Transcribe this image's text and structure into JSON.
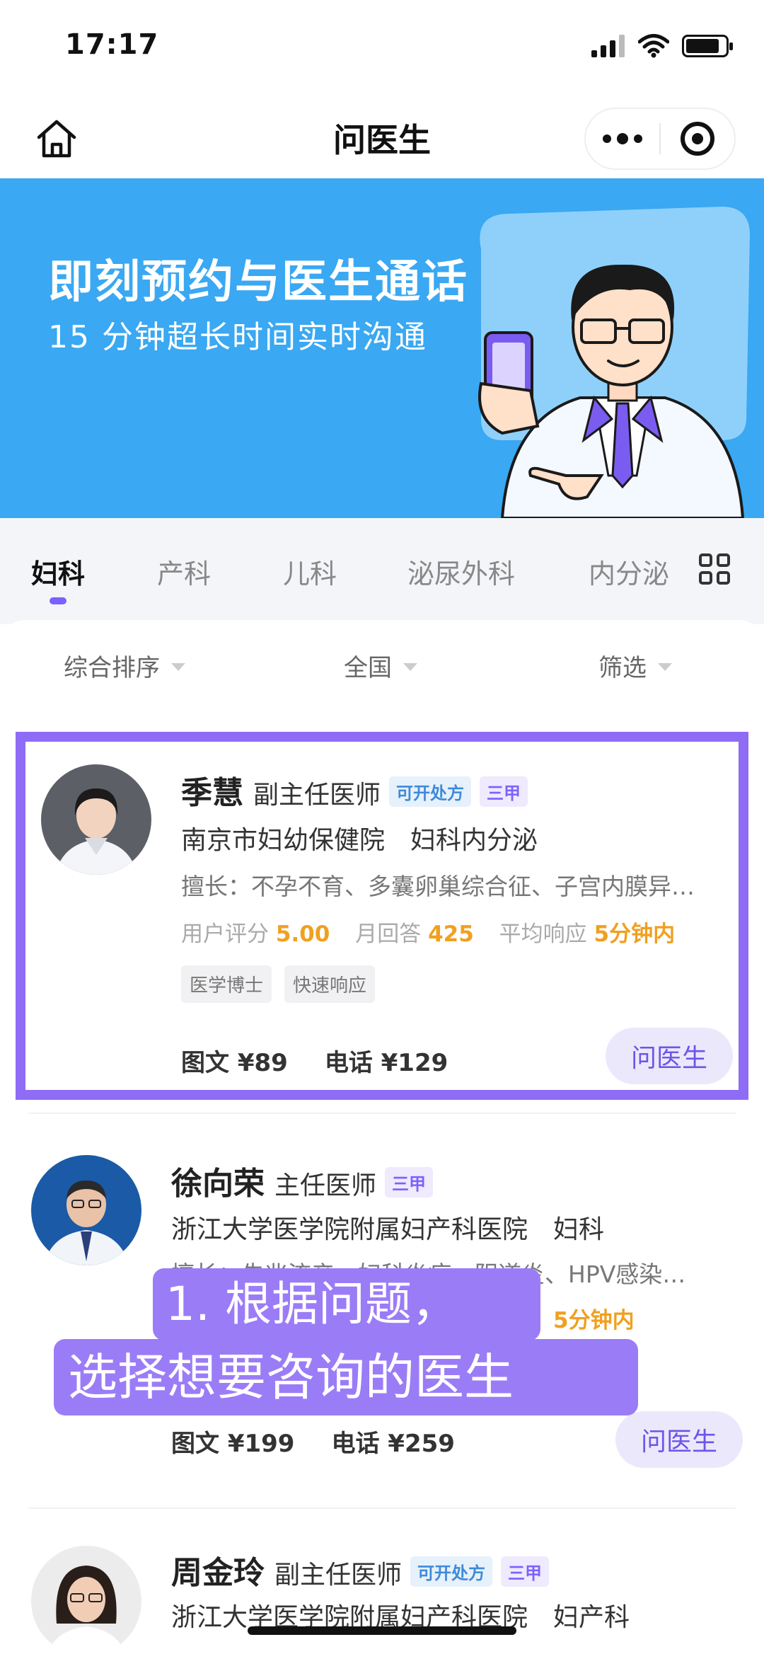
{
  "status_bar": {
    "time": "17:17"
  },
  "nav": {
    "title": "问医生"
  },
  "banner": {
    "title": "即刻预约与医生通话",
    "subtitle": "15 分钟超长时间实时沟通"
  },
  "tabs": [
    {
      "label": "妇科",
      "active": true
    },
    {
      "label": "产科",
      "active": false
    },
    {
      "label": "儿科",
      "active": false
    },
    {
      "label": "泌尿外科",
      "active": false
    },
    {
      "label": "内分泌",
      "active": false
    }
  ],
  "filters": {
    "sort": "综合排序",
    "region": "全国",
    "filter": "筛选"
  },
  "doctors": [
    {
      "name": "季慧",
      "title": "副主任医师",
      "badges": [
        "可开处方",
        "三甲"
      ],
      "hospital": "南京市妇幼保健院　妇科内分泌",
      "specialty": "擅长：不孕不育、多囊卵巢综合征、子宫内膜异…",
      "rating_label": "用户评分",
      "rating": "5.00",
      "monthly_label": "月回答",
      "monthly": "425",
      "response_label": "平均响应",
      "response": "5分钟内",
      "tags": [
        "医学博士",
        "快速响应"
      ],
      "price_text": "图文 ¥89",
      "price_phone": "电话 ¥129",
      "button": "问医生"
    },
    {
      "name": "徐向荣",
      "title": "主任医师",
      "badges": [
        "三甲"
      ],
      "hospital": "浙江大学医学院附属妇产科医院　妇科",
      "specialty": "擅长：先兆流产、妇科炎症、阴道炎、HPV感染…",
      "response": "5分钟内",
      "price_text": "图文 ¥199",
      "price_phone": "电话 ¥259",
      "button": "问医生"
    },
    {
      "name": "周金玲",
      "title": "副主任医师",
      "badges": [
        "可开处方",
        "三甲"
      ],
      "hospital": "浙江大学医学院附属妇产科医院　妇产科"
    }
  ],
  "caption": {
    "line1": "1. 根据问题，",
    "line2": "选择想要咨询的医生"
  },
  "colors": {
    "banner": "#3aa8f2",
    "accent": "#7b61ff",
    "highlight_border": "#8f6cf5",
    "stat_value": "#f0a020"
  }
}
